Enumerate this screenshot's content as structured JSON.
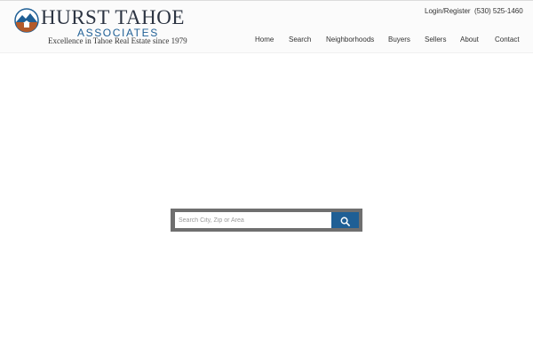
{
  "brand": {
    "name_line1": "HURST TAHOE",
    "name_line2": "ASSOCIATES",
    "tagline": "Excellence in Tahoe Real Estate since 1979",
    "logo_icon": "mountain-house-icon",
    "colors": {
      "navy": "#2c3442",
      "blue": "#1f5f95",
      "roof": "#b35a2a"
    }
  },
  "utility": {
    "login_label": "Login/Register",
    "phone": "(530) 525-1460"
  },
  "nav": [
    {
      "label": "Home"
    },
    {
      "label": "Search"
    },
    {
      "label": "Neighborhoods"
    },
    {
      "label": "Buyers"
    },
    {
      "label": "Sellers"
    },
    {
      "label": "About"
    },
    {
      "label": "Contact"
    }
  ],
  "search": {
    "placeholder": "Search City, Zip or Area",
    "button_icon": "search-icon",
    "button_color": "#1f5f95",
    "frame_color": "#6f6f6f"
  }
}
